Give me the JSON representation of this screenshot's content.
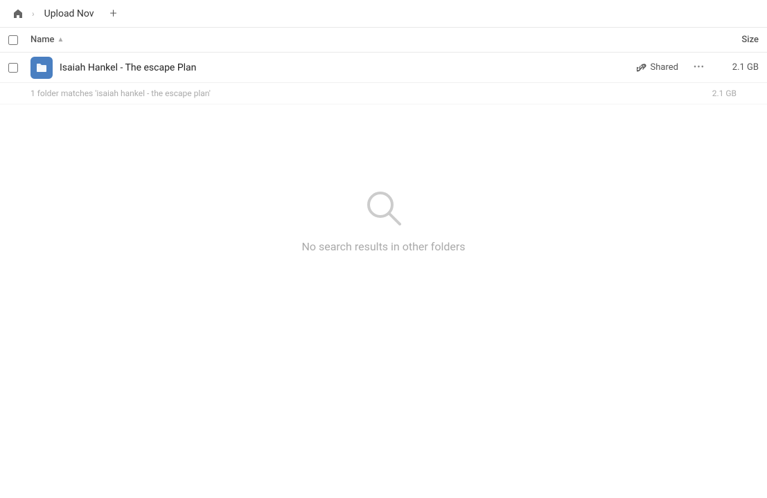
{
  "topbar": {
    "home_label": "Home",
    "breadcrumb_item": "Upload Nov",
    "add_btn_label": "+"
  },
  "columns": {
    "name_label": "Name",
    "sort_arrow": "▲",
    "size_label": "Size"
  },
  "file_row": {
    "name": "Isaiah Hankel - The escape Plan",
    "shared_label": "Shared",
    "more_label": "•••",
    "size": "2.1 GB"
  },
  "summary": {
    "text": "1 folder matches 'isaiah hankel - the escape plan'",
    "size": "2.1 GB"
  },
  "empty_state": {
    "message": "No search results in other folders"
  }
}
